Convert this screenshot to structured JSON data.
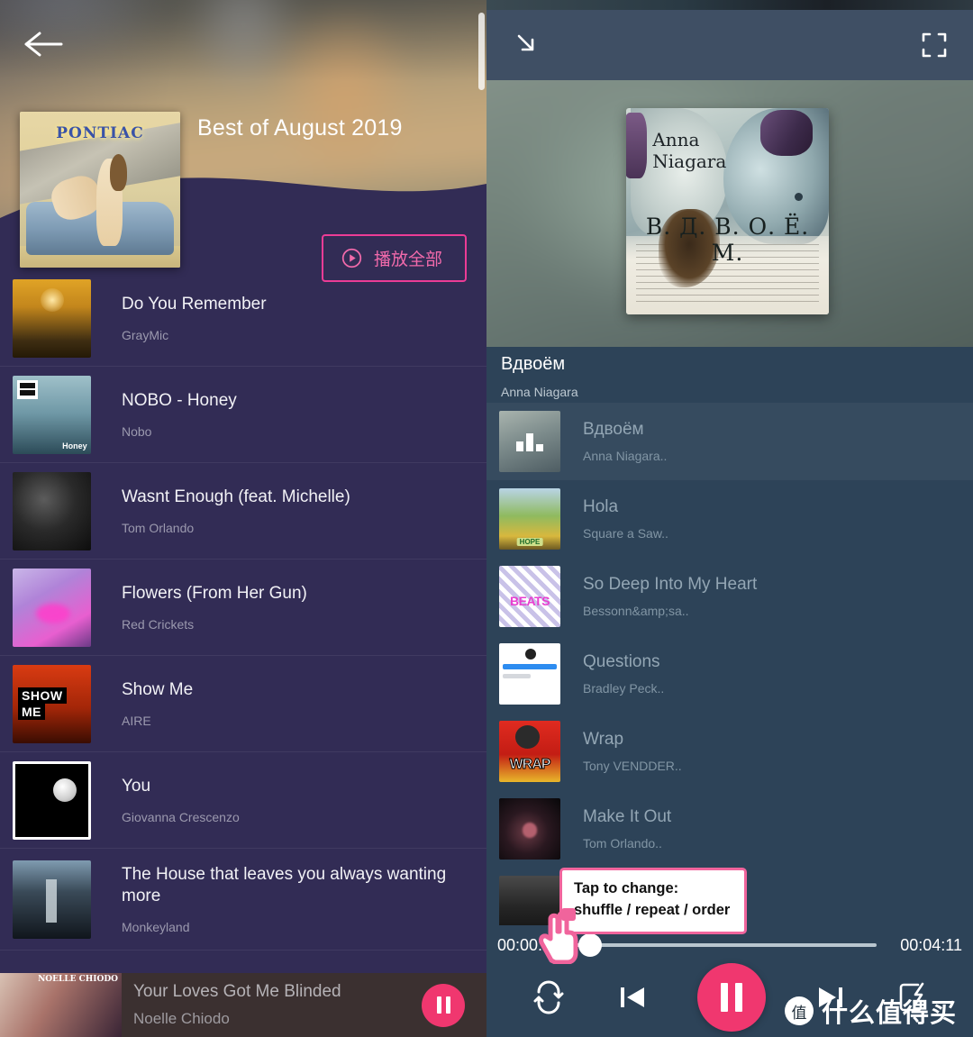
{
  "colors": {
    "accent_pink": "#f0376f",
    "outline_pink": "#ec3c96",
    "left_list_bg": "#322c55",
    "right_bg": "#2d4358",
    "right_topbar": "#3f4f64",
    "mini_player_bg": "#3b3030"
  },
  "left": {
    "back_icon": "back-arrow-icon",
    "playlist_title": "Best of August 2019",
    "cover_label": "PONTIAC",
    "play_all": {
      "label": "播放全部",
      "icon": "play-circle-icon"
    },
    "tracks": [
      {
        "name": "Do You Remember",
        "artist": "GrayMic",
        "art": "a-moon"
      },
      {
        "name": "NOBO - Honey",
        "artist": "Nobo",
        "art": "a-nobo"
      },
      {
        "name": "Wasnt Enough (feat. Michelle)",
        "artist": "Tom Orlando",
        "art": "a-dark"
      },
      {
        "name": "Flowers (From Her Gun)",
        "artist": "Red Crickets",
        "art": "a-pink"
      },
      {
        "name": "Show Me",
        "artist": "AIRE",
        "art": "a-show"
      },
      {
        "name": "You",
        "artist": "Giovanna Crescenzo",
        "art": "a-you"
      },
      {
        "name": "The House that leaves you always wanting more",
        "artist": "Monkeyland",
        "art": "a-house"
      }
    ],
    "mini_player": {
      "name": "Your Loves Got Me Blinded",
      "artist": "Noelle Chiodo",
      "art_label": "NOELLE CHIODO",
      "button_icon": "pause-icon"
    }
  },
  "right": {
    "topbar": {
      "collapse_icon": "collapse-down-right-icon",
      "fullscreen_icon": "fullscreen-expand-icon"
    },
    "album_art": {
      "artist_line": "Anna\nNiagara",
      "title_line": "В. Д. В. О. Ё. М."
    },
    "now_playing": {
      "title": "Вдвоём",
      "artist": "Anna Niagara"
    },
    "queue": [
      {
        "name": "Вдвоём",
        "artist": "Anna Niagara..",
        "art": "q-anna",
        "current": true
      },
      {
        "name": "Hola",
        "artist": "Square a Saw..",
        "art": "q-hola",
        "current": false
      },
      {
        "name": "So Deep Into My Heart",
        "artist": "Bessonn&amp;sa..",
        "art": "q-beats",
        "current": false
      },
      {
        "name": "Questions",
        "artist": "Bradley Peck..",
        "art": "q-quest",
        "current": false
      },
      {
        "name": "Wrap",
        "artist": "Tony VENDDER..",
        "art": "q-wrap",
        "current": false
      },
      {
        "name": "Make It Out",
        "artist": "Tom Orlando..",
        "art": "q-make",
        "current": false
      }
    ],
    "controls": {
      "current_time": "00:00:2",
      "total_time": "00:04:11",
      "progress_percent": 9,
      "repeat_icon": "repeat-icon",
      "previous_icon": "skip-previous-icon",
      "playpause_icon": "pause-icon",
      "next_icon": "skip-next-icon",
      "cast_icon": "device-cast-icon"
    }
  },
  "annotation": {
    "tooltip_line1": "Tap to change:",
    "tooltip_line2": "shuffle / repeat / order",
    "cursor_icon": "hand-pointer-cursor"
  },
  "watermark": {
    "logo_char": "值",
    "text": "什么值得买"
  }
}
